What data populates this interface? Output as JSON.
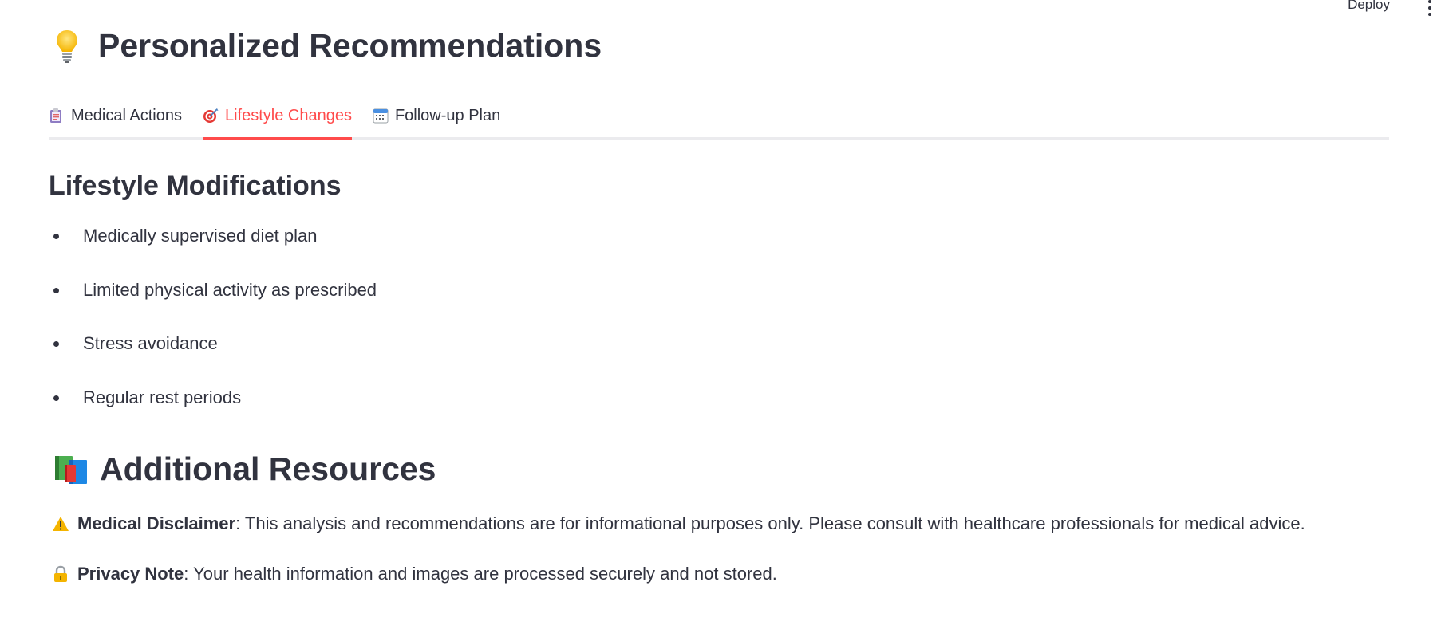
{
  "header": {
    "deploy_label": "Deploy",
    "menu_icon": "kebab-menu-icon"
  },
  "page": {
    "title": "Personalized Recommendations",
    "title_icon": "light-bulb-icon"
  },
  "tabs": [
    {
      "label": "Medical Actions",
      "icon": "clipboard-icon",
      "active": false
    },
    {
      "label": "Lifestyle Changes",
      "icon": "target-icon",
      "active": true
    },
    {
      "label": "Follow-up Plan",
      "icon": "calendar-icon",
      "active": false
    }
  ],
  "lifestyle": {
    "heading": "Lifestyle Modifications",
    "items": [
      "Medically supervised diet plan",
      "Limited physical activity as prescribed",
      "Stress avoidance",
      "Regular rest periods"
    ]
  },
  "resources": {
    "title": "Additional Resources",
    "title_icon": "books-icon",
    "disclaimer_label": "Medical Disclaimer",
    "disclaimer_text": ": This analysis and recommendations are for informational purposes only. Please consult with healthcare professionals for medical advice.",
    "disclaimer_icon": "warning-icon",
    "privacy_label": "Privacy Note",
    "privacy_text": ": Your health information and images are processed securely and not stored.",
    "privacy_icon": "lock-icon"
  },
  "colors": {
    "accent": "#ff4b4b",
    "text": "#31333f",
    "tab_border": "#ebebee"
  }
}
